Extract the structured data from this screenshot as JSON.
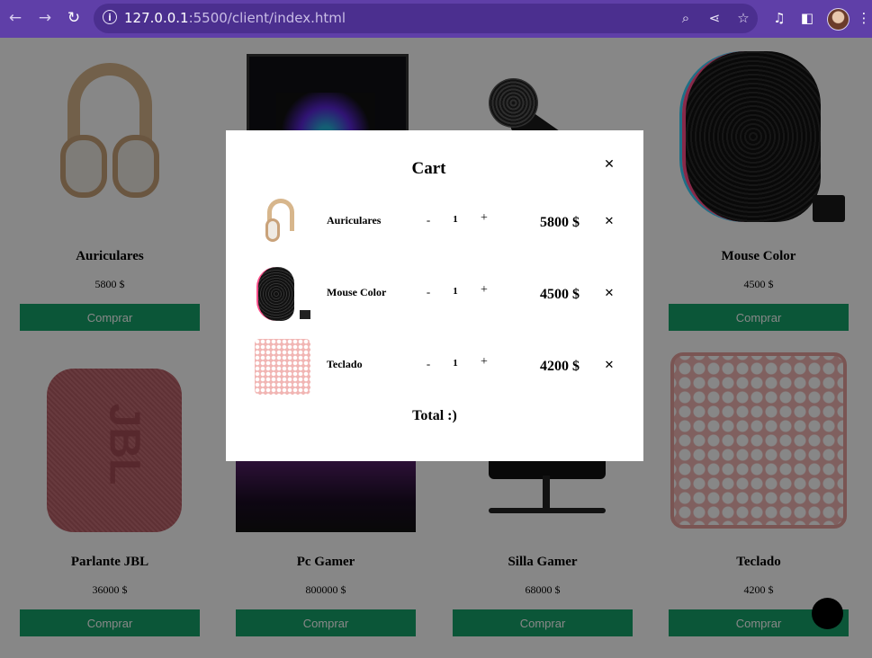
{
  "browser": {
    "url_host": "127.0.0.1",
    "url_path": ":5500/client/index.html"
  },
  "products": [
    {
      "name": "Auriculares",
      "price": "5800 $",
      "buy_label": "Comprar"
    },
    {
      "name": "Mouse Color",
      "price": "4500 $",
      "buy_label": "Comprar"
    },
    {
      "name": "Parlante JBL",
      "price": "36000 $",
      "buy_label": "Comprar"
    },
    {
      "name": "Pc Gamer",
      "price": "800000 $",
      "buy_label": "Comprar"
    },
    {
      "name": "Silla Gamer",
      "price": "68000 $",
      "buy_label": "Comprar"
    },
    {
      "name": "Teclado",
      "price": "4200 $",
      "buy_label": "Comprar"
    }
  ],
  "cart": {
    "title": "Cart",
    "close": "✕",
    "items": [
      {
        "name": "Auriculares",
        "minus": "-",
        "qty": "1",
        "plus": "+",
        "price": "5800 $",
        "remove": "✕"
      },
      {
        "name": "Mouse Color",
        "minus": "-",
        "qty": "1",
        "plus": "+",
        "price": "4500 $",
        "remove": "✕"
      },
      {
        "name": "Teclado",
        "minus": "-",
        "qty": "1",
        "plus": "+",
        "price": "4200 $",
        "remove": "✕"
      }
    ],
    "total": "Total :)"
  },
  "icons": {
    "back": "back-arrow-icon",
    "forward": "forward-arrow-icon",
    "reload": "reload-icon",
    "site_info": "site-info-icon",
    "zoom": "zoom-icon",
    "share": "share-icon",
    "bookmark": "star-icon",
    "media": "media-icon",
    "side_panel": "side-panel-icon",
    "menu": "kebab-menu-icon"
  },
  "colors": {
    "browser_chrome": "#5f3fa8",
    "buy_button": "#16a36a",
    "overlay": "rgba(0,0,0,0.47)"
  }
}
